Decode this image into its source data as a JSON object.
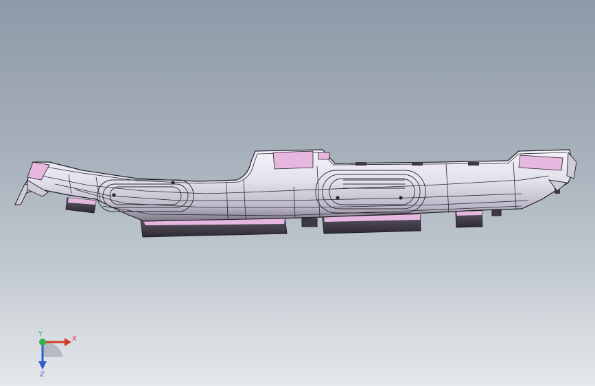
{
  "viewport": {
    "model_name": "",
    "colors": {
      "background_top": "#8e9aa8",
      "background_bottom": "#e6e9ec",
      "part_face": "#e4e2ee",
      "part_shadow": "#6d6876",
      "pink_face": "#e6b8e0",
      "dark_block": "#3d3844",
      "edge": "#1f1d24"
    }
  },
  "triad": {
    "x_label": "X",
    "y_label": "Y",
    "z_label": "Z",
    "x_color": "#d23a2a",
    "y_color": "#2fb34a",
    "z_color": "#2f5bd2"
  }
}
